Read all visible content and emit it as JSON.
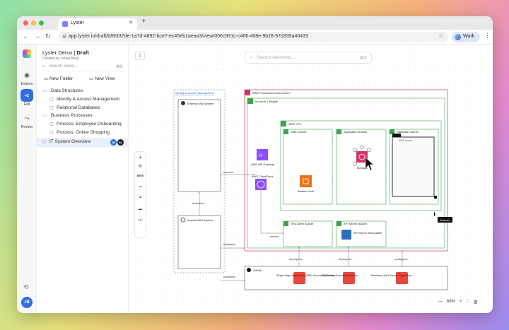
{
  "browser": {
    "tab_title": "Lyster",
    "url": "app.lyster.io/draft/b89337de-1a7d-4892-bce7-ec45eb1aeaa3/view/056c931c-c466-468e-9b28-97d335a46433",
    "profile_label": "Work"
  },
  "rail": {
    "explore": "Explore",
    "edit": "Edit",
    "review": "Review",
    "avatar": "JB"
  },
  "sidebar": {
    "project": "Lyster Demo",
    "status": "Draft",
    "created_by": "Created by Jonas Berg",
    "search_placeholder": "Search views...",
    "search_shortcut": "⌘K",
    "new_folder": "New Folder",
    "new_view": "New View",
    "tree": [
      {
        "label": "Data Structures",
        "type": "folder"
      },
      {
        "label": "Identity & Access Management",
        "type": "view"
      },
      {
        "label": "Relational Databases",
        "type": "view"
      },
      {
        "label": "Business Processes",
        "type": "folder"
      },
      {
        "label": "Process: Employee Onboarding",
        "type": "view"
      },
      {
        "label": "Process: Online Shopping",
        "type": "view"
      },
      {
        "label": "IT System Overview",
        "type": "view",
        "selected": true,
        "avatars": [
          "JB",
          "SL"
        ]
      }
    ]
  },
  "canvas": {
    "search_placeholder": "Search elements...",
    "search_shortcut": "⌘F",
    "toolbox": [
      "+",
      "aws",
      "gcp",
      "azure",
      "</>"
    ],
    "zoom_level": "68%"
  },
  "diagram": {
    "iam_group": "Identity & Access Management",
    "external_iam": "External IAM System",
    "internal_iam": "Internal IAM System",
    "aws_env": "AWS Production Environment",
    "region": "eu-north-1 Region",
    "vpc": "AWS VPC",
    "dmz": "DMZ Subnet",
    "app_subnet": "Application Subnet",
    "db_subnet": "Database Subnet",
    "api_gateway": "AWS API Gateway",
    "cloudfront": "AWS CloudFront",
    "bastion": "Bastion Host",
    "manager": "Manager",
    "aurora": "AWS Aurora",
    "cursor_user": "Samuel",
    "spa_bucket": "SPA Client Bucket",
    "api_bucket": "API Server Bucket",
    "api_exec": "API Server Executable",
    "github": "GitHub",
    "spa_repo": "Single Page Application (SPA) Source Repository",
    "api_repo": "API Server Source Repository",
    "tf_repo": "Terraform (IaC) Source Repository",
    "edge_secures": "secures",
    "edge_federates_1": "federates",
    "edge_federates_2": "federates",
    "edge_federates_3": "federates",
    "edge_serves": "serves",
    "edge_deploys_1": "deploys to",
    "edge_deploys_2": "deploys to",
    "edge_configures": "configures",
    "colors": {
      "aws_pink": "#d6336c",
      "aws_green": "#3fa34d",
      "api_purple": "#8c4fff",
      "orange": "#e8741a",
      "git_red": "#e8473a",
      "cursor_blue": "#2f6fe0"
    }
  }
}
